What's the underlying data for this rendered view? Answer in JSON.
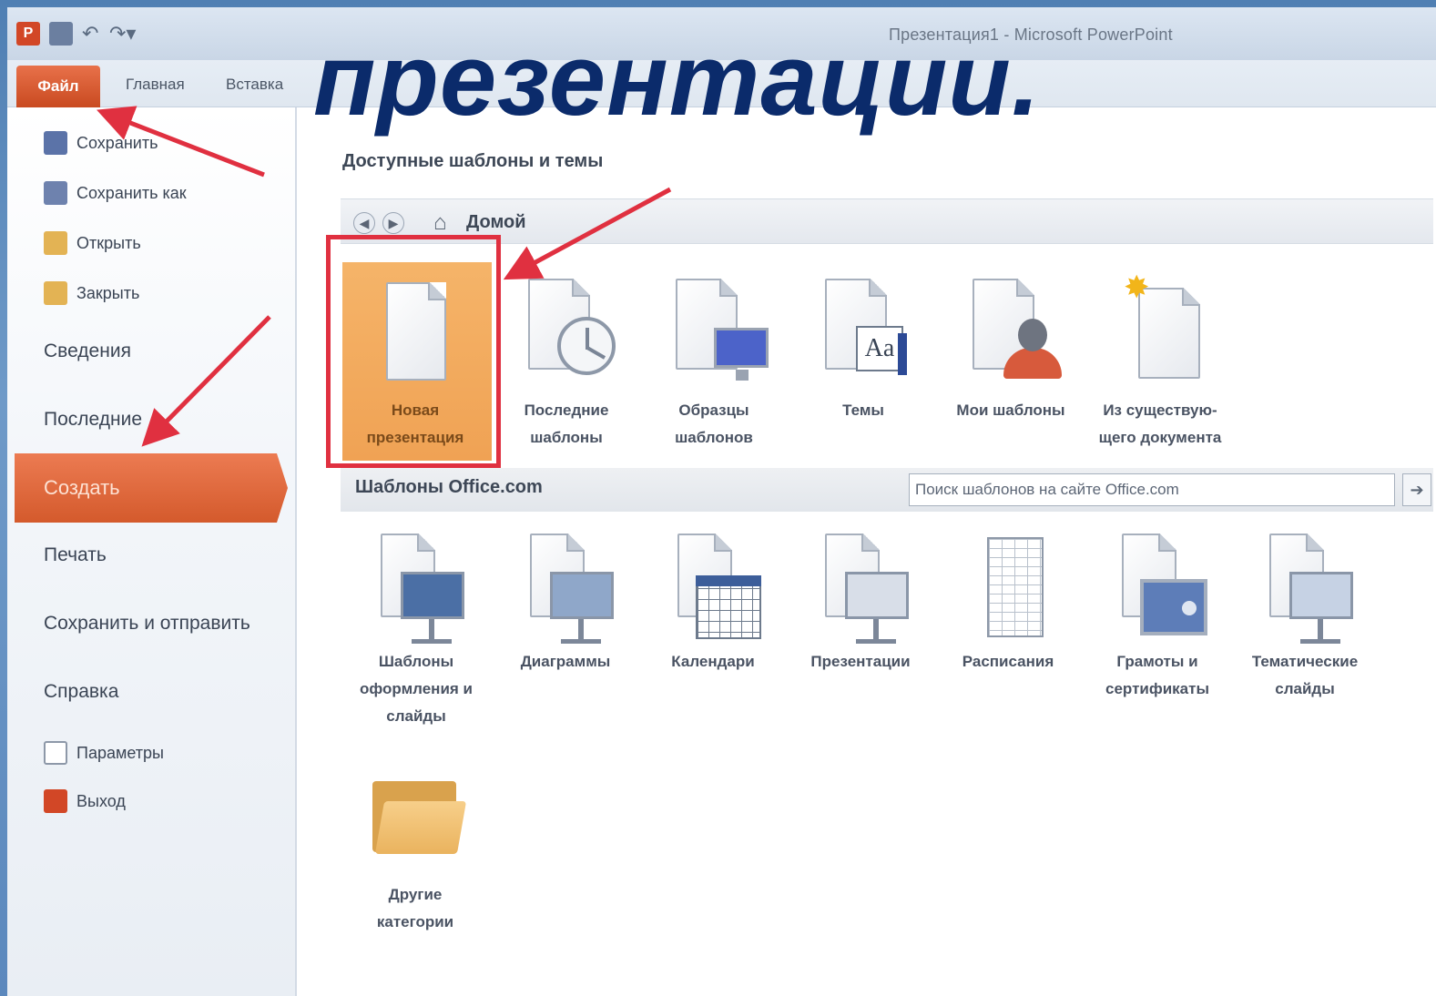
{
  "window": {
    "title": "Презентация1 - Microsoft PowerPoint",
    "app_badge": "P"
  },
  "overlay_heading": "презентации.",
  "ribbon": {
    "tabs": [
      "Файл",
      "Главная",
      "Вставка"
    ]
  },
  "backstage_nav": {
    "save": "Сохранить",
    "save_as": "Сохранить как",
    "open": "Открыть",
    "close": "Закрыть",
    "info": "Сведения",
    "recent": "Последние",
    "create": "Создать",
    "print": "Печать",
    "save_send": "Сохранить и отправить",
    "help": "Справка",
    "options": "Параметры",
    "exit": "Выход"
  },
  "main": {
    "section_heading": "Доступные шаблоны и темы",
    "home_label": "Домой",
    "available": [
      {
        "label_1": "Новая",
        "label_2": "презентация"
      },
      {
        "label_1": "Последние",
        "label_2": "шаблоны"
      },
      {
        "label_1": "Образцы",
        "label_2": "шаблонов"
      },
      {
        "label_1": "Темы",
        "label_2": ""
      },
      {
        "label_1": "Мои шаблоны",
        "label_2": ""
      },
      {
        "label_1": "Из существую-",
        "label_2": "щего документа"
      }
    ],
    "themes_icon_text": "Aa",
    "office": {
      "label": "Шаблоны Office.com",
      "search_placeholder": "Поиск шаблонов на сайте Office.com"
    },
    "categories": [
      {
        "l1": "Шаблоны",
        "l2": "оформления и",
        "l3": "слайды"
      },
      {
        "l1": "Диаграммы",
        "l2": "",
        "l3": ""
      },
      {
        "l1": "Календари",
        "l2": "",
        "l3": ""
      },
      {
        "l1": "Презентации",
        "l2": "",
        "l3": ""
      },
      {
        "l1": "Расписания",
        "l2": "",
        "l3": ""
      },
      {
        "l1": "Грамоты и",
        "l2": "сертификаты",
        "l3": ""
      },
      {
        "l1": "Тематические",
        "l2": "слайды",
        "l3": ""
      }
    ],
    "other": {
      "l1": "Другие",
      "l2": "категории"
    }
  },
  "colors": {
    "file_tab": "#d45a2c",
    "highlight": "#f0a254",
    "annotation_red": "#e03040",
    "heading_navy": "#0b2b6b"
  }
}
